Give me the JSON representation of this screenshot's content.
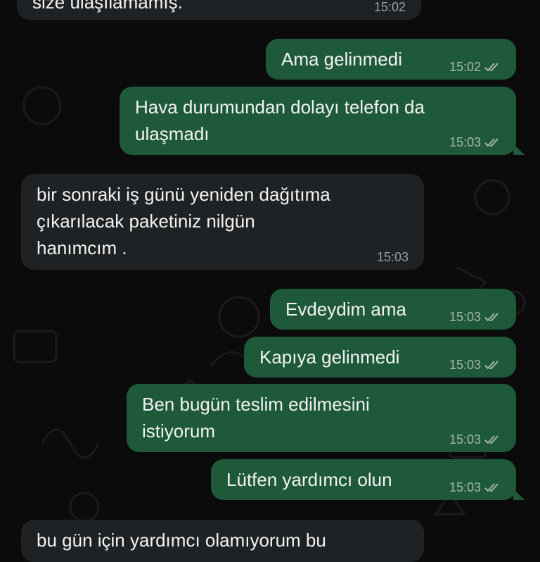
{
  "messages": [
    {
      "dir": "in",
      "text": "size ulaşılamamış.",
      "time": "15:02"
    },
    {
      "dir": "out",
      "text": "Ama gelinmedi",
      "time": "15:02"
    },
    {
      "dir": "out",
      "text": "Hava durumundan dolayı telefon da\nulaşmadı",
      "time": "15:03"
    },
    {
      "dir": "in",
      "text": "bir sonraki iş günü yeniden dağıtıma\nçıkarılacak paketiniz nilgün\nhanımcım .",
      "time": "15:03"
    },
    {
      "dir": "out",
      "text": "Evdeydim ama",
      "time": "15:03"
    },
    {
      "dir": "out",
      "text": "Kapıya gelinmedi",
      "time": "15:03"
    },
    {
      "dir": "out",
      "text": "Ben bugün teslim edilmesini\nistiyorum",
      "time": "15:03"
    },
    {
      "dir": "out",
      "text": "Lütfen yardımcı olun",
      "time": "15:03"
    },
    {
      "dir": "in",
      "text": "bu gün için yardımcı olamıyorum bu",
      "time": ""
    }
  ],
  "icons": {
    "read_receipt": "double-check-icon"
  },
  "colors": {
    "incoming": "#1f2224",
    "outgoing": "#1e5a3a",
    "background": "#0b0b0b"
  }
}
